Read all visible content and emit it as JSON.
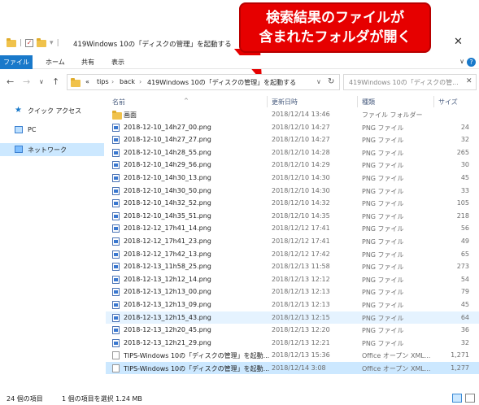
{
  "window": {
    "title": "419Windows 10の「ディスクの管理」を起動する",
    "close_glyph": "✕"
  },
  "callout": {
    "line1": "検索結果のファイルが",
    "line2": "含まれたフォルダが開く"
  },
  "ribbon": {
    "tabs": [
      "ファイル",
      "ホーム",
      "共有",
      "表示"
    ],
    "collapse_glyph": "∨",
    "help_glyph": "?"
  },
  "nav": {
    "back": "←",
    "forward": "→",
    "recent": "∨",
    "up": "↑",
    "breadcrumb": [
      "«",
      "tips",
      "back",
      "419Windows 10の「ディスクの管理」を起動する"
    ],
    "sep": "›",
    "dropdown": "∨",
    "refresh": "↻",
    "search_placeholder": "419Windows 10の「ディスクの管...",
    "search_clear": "✕"
  },
  "sidebar": {
    "items": [
      {
        "label": "クイック アクセス",
        "icon": "star-icon",
        "selected": false
      },
      {
        "label": "PC",
        "icon": "pc-icon",
        "selected": false
      },
      {
        "label": "ネットワーク",
        "icon": "network-icon",
        "selected": true
      }
    ]
  },
  "columns": {
    "name": "名前",
    "date": "更新日時",
    "type": "種類",
    "size": "サイズ",
    "sort_glyph": "^"
  },
  "files": [
    {
      "name": "画面",
      "date": "2018/12/14 13:46",
      "type": "ファイル フォルダー",
      "size": "",
      "icon": "folder-icon",
      "state": ""
    },
    {
      "name": "2018-12-10_14h27_00.png",
      "date": "2018/12/10 14:27",
      "type": "PNG ファイル",
      "size": "24",
      "icon": "png-icon",
      "state": ""
    },
    {
      "name": "2018-12-10_14h27_27.png",
      "date": "2018/12/10 14:27",
      "type": "PNG ファイル",
      "size": "32",
      "icon": "png-icon",
      "state": ""
    },
    {
      "name": "2018-12-10_14h28_55.png",
      "date": "2018/12/10 14:28",
      "type": "PNG ファイル",
      "size": "265",
      "icon": "png-icon",
      "state": ""
    },
    {
      "name": "2018-12-10_14h29_56.png",
      "date": "2018/12/10 14:29",
      "type": "PNG ファイル",
      "size": "30",
      "icon": "png-icon",
      "state": ""
    },
    {
      "name": "2018-12-10_14h30_13.png",
      "date": "2018/12/10 14:30",
      "type": "PNG ファイル",
      "size": "45",
      "icon": "png-icon",
      "state": ""
    },
    {
      "name": "2018-12-10_14h30_50.png",
      "date": "2018/12/10 14:30",
      "type": "PNG ファイル",
      "size": "33",
      "icon": "png-icon",
      "state": ""
    },
    {
      "name": "2018-12-10_14h32_52.png",
      "date": "2018/12/10 14:32",
      "type": "PNG ファイル",
      "size": "105",
      "icon": "png-icon",
      "state": ""
    },
    {
      "name": "2018-12-10_14h35_51.png",
      "date": "2018/12/10 14:35",
      "type": "PNG ファイル",
      "size": "218",
      "icon": "png-icon",
      "state": ""
    },
    {
      "name": "2018-12-12_17h41_14.png",
      "date": "2018/12/12 17:41",
      "type": "PNG ファイル",
      "size": "56",
      "icon": "png-icon",
      "state": ""
    },
    {
      "name": "2018-12-12_17h41_23.png",
      "date": "2018/12/12 17:41",
      "type": "PNG ファイル",
      "size": "49",
      "icon": "png-icon",
      "state": ""
    },
    {
      "name": "2018-12-12_17h42_13.png",
      "date": "2018/12/12 17:42",
      "type": "PNG ファイル",
      "size": "65",
      "icon": "png-icon",
      "state": ""
    },
    {
      "name": "2018-12-13_11h58_25.png",
      "date": "2018/12/13 11:58",
      "type": "PNG ファイル",
      "size": "273",
      "icon": "png-icon",
      "state": ""
    },
    {
      "name": "2018-12-13_12h12_14.png",
      "date": "2018/12/13 12:12",
      "type": "PNG ファイル",
      "size": "54",
      "icon": "png-icon",
      "state": ""
    },
    {
      "name": "2018-12-13_12h13_00.png",
      "date": "2018/12/13 12:13",
      "type": "PNG ファイル",
      "size": "79",
      "icon": "png-icon",
      "state": ""
    },
    {
      "name": "2018-12-13_12h13_09.png",
      "date": "2018/12/13 12:13",
      "type": "PNG ファイル",
      "size": "45",
      "icon": "png-icon",
      "state": ""
    },
    {
      "name": "2018-12-13_12h15_43.png",
      "date": "2018/12/13 12:15",
      "type": "PNG ファイル",
      "size": "64",
      "icon": "png-icon",
      "state": "hl"
    },
    {
      "name": "2018-12-13_12h20_45.png",
      "date": "2018/12/13 12:20",
      "type": "PNG ファイル",
      "size": "36",
      "icon": "png-icon",
      "state": ""
    },
    {
      "name": "2018-12-13_12h21_29.png",
      "date": "2018/12/13 12:21",
      "type": "PNG ファイル",
      "size": "32",
      "icon": "png-icon",
      "state": ""
    },
    {
      "name": "TIPS-Windows 10の「ディスクの管理」を起動...",
      "date": "2018/12/13 15:36",
      "type": "Office オープン XML...",
      "size": "1,271",
      "icon": "doc-icon",
      "state": ""
    },
    {
      "name": "TIPS-Windows 10の「ディスクの管理」を起動...",
      "date": "2018/12/14 3:08",
      "type": "Office オープン XML...",
      "size": "1,277",
      "icon": "doc-icon",
      "state": "sel"
    }
  ],
  "status": {
    "count": "24 個の項目",
    "selection": "1 個の項目を選択 1.24 MB"
  }
}
